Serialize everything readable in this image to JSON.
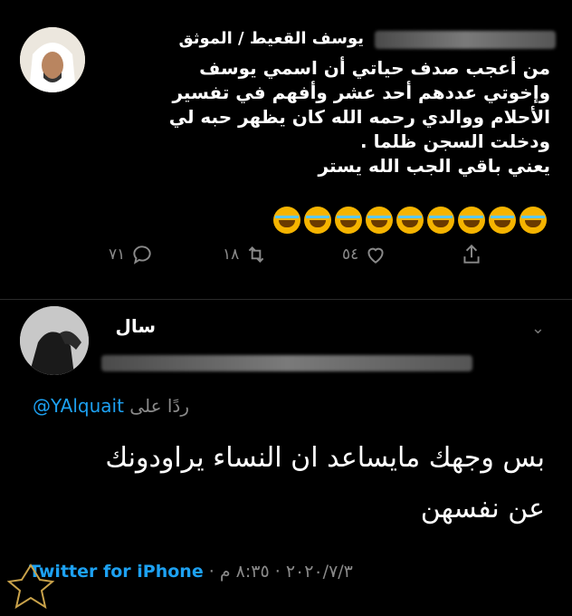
{
  "tweet": {
    "display_name": "يوسف القعيط / الموثق",
    "body_lines": [
      "من أعجب صدف حياتي أن اسمي يوسف",
      "وإخوتي عددهم أحد عشر وأفهم في تفسير",
      "الأحلام ووالدي رحمه الله كان يظهر حبه لي",
      "ودخلت السجن ظلما .",
      "يعني باقي الجب الله يستر"
    ],
    "emoji_count": 9,
    "emoji_name": "face-with-tears-of-joy",
    "actions": {
      "reply_count": "٧١",
      "retweet_count": "١٨",
      "like_count": "٥٤"
    }
  },
  "reply": {
    "display_name": "سال",
    "replying_to_label": "ردًا على",
    "replying_to_handle": "@YAlquait",
    "text_line1": "بس وجهك مايساعد ان النساء يراودونك",
    "text_line2": "عن نفسهن",
    "time": "٨:٣٥ م",
    "date": "٢٠٢٠/٧/٣",
    "client": "Twitter for iPhone"
  },
  "colors": {
    "background": "#000000",
    "link": "#1da1f2",
    "muted": "#8a8a8a"
  }
}
